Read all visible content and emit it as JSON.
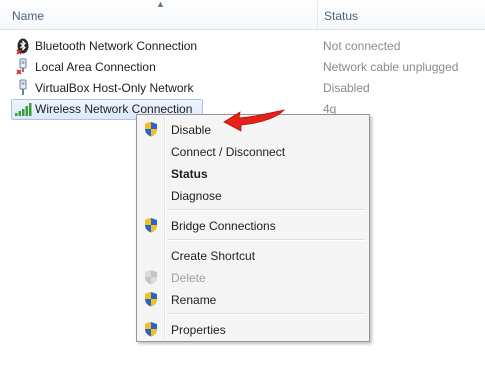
{
  "header": {
    "name_col": "Name",
    "status_col": "Status"
  },
  "connections": [
    {
      "name": "Bluetooth Network Connection",
      "status": "Not connected",
      "icon": "bluetooth-icon"
    },
    {
      "name": "Local Area Connection",
      "status": "Network cable unplugged",
      "icon": "ethernet-unplugged-icon"
    },
    {
      "name": "VirtualBox Host-Only Network",
      "status": "Disabled",
      "icon": "ethernet-icon"
    },
    {
      "name": "Wireless Network Connection",
      "status": "4g",
      "icon": "wireless-signal-icon"
    }
  ],
  "menu": {
    "disable": "Disable",
    "connect": "Connect / Disconnect",
    "status": "Status",
    "diagnose": "Diagnose",
    "bridge": "Bridge Connections",
    "shortcut": "Create Shortcut",
    "delete": "Delete",
    "rename": "Rename",
    "properties": "Properties"
  },
  "colors": {
    "arrow": "#e8201a",
    "selection": "#dbeafa",
    "shield_blue": "#2f62c9",
    "shield_yellow": "#f2c21a"
  }
}
